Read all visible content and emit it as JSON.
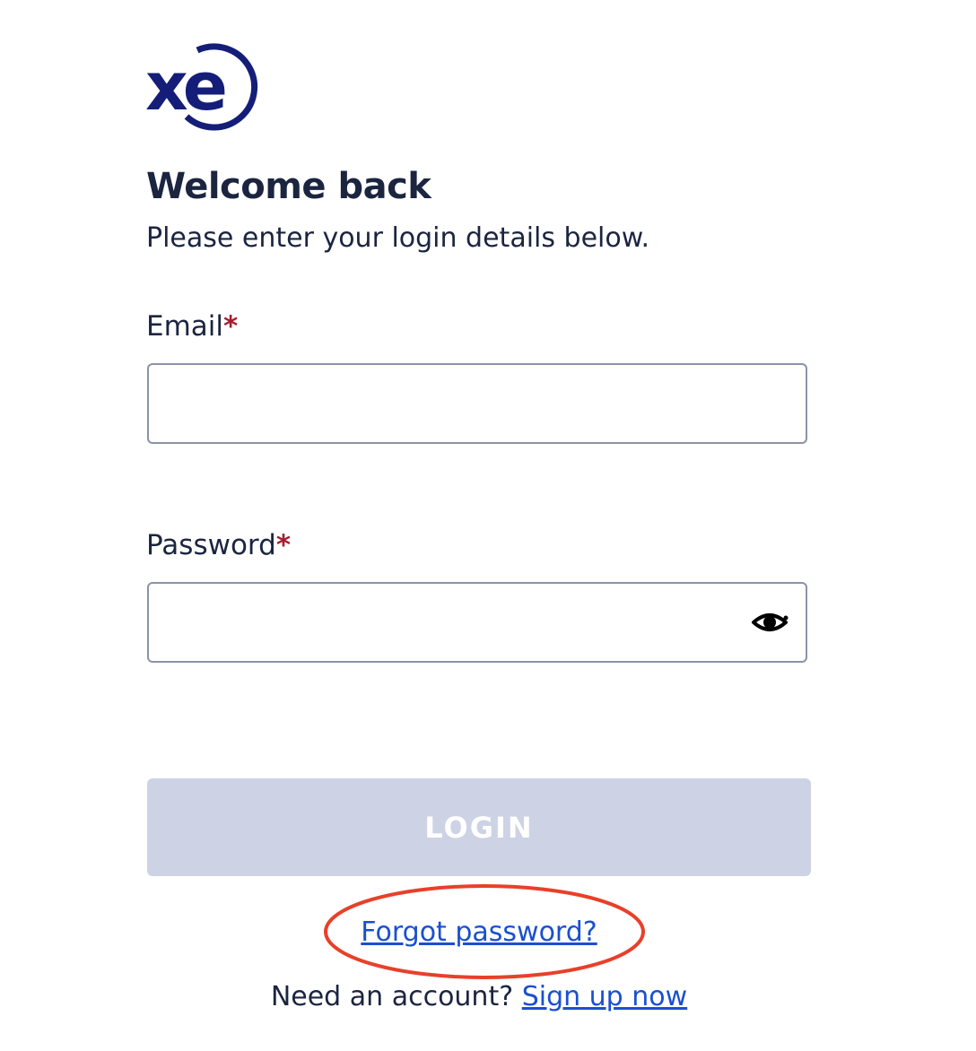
{
  "brand": {
    "logo_text": "xe",
    "color": "#141e78"
  },
  "header": {
    "title": "Welcome back",
    "subtitle": "Please enter your login details below."
  },
  "form": {
    "email": {
      "label": "Email",
      "required_mark": "*",
      "value": "",
      "placeholder": ""
    },
    "password": {
      "label": "Password",
      "required_mark": "*",
      "value": "",
      "placeholder": "",
      "toggle_icon": "eye-icon"
    },
    "login_label": "LOGIN"
  },
  "links": {
    "forgot_password": "Forgot password?",
    "need_account": "Need an account?",
    "sign_up": "Sign up now"
  },
  "colors": {
    "text": "#1b2540",
    "required": "#a51c30",
    "link": "#1a4fd0",
    "button_disabled": "#cdd3e5",
    "annotation": "#e8402a"
  }
}
